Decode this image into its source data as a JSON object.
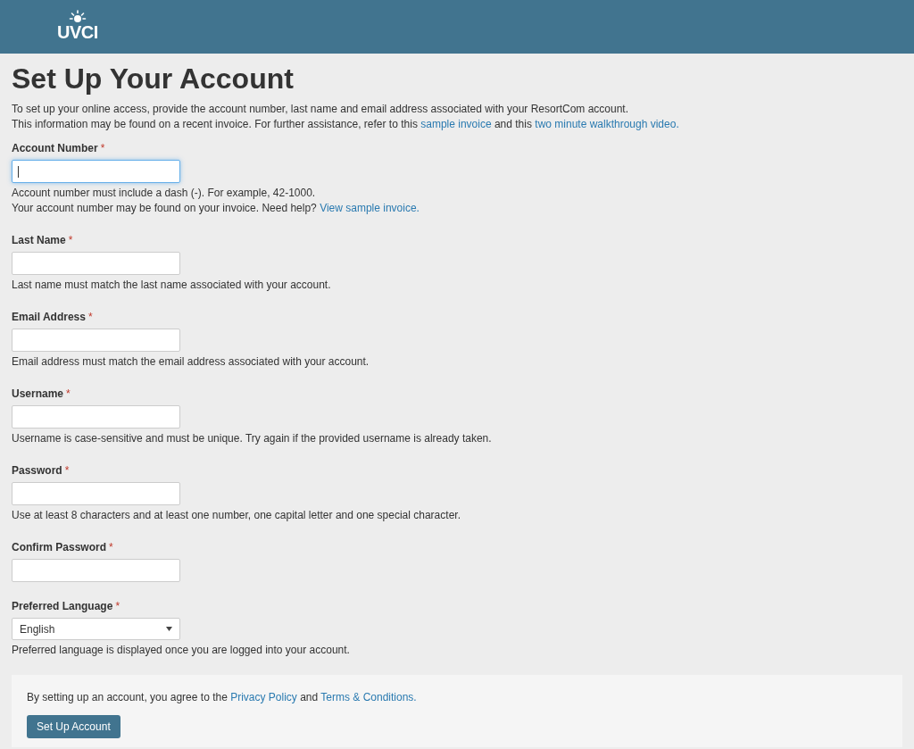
{
  "header": {
    "logo_text": "UVCI"
  },
  "title": "Set Up Your Account",
  "intro": [
    [
      {
        "kind": "text",
        "text": "To set up your online access, provide the account number, last name and email address associated with your ResortCom account."
      }
    ],
    [
      {
        "kind": "text",
        "text": "This information may be found on a recent invoice. For further assistance, refer to this "
      },
      {
        "kind": "link",
        "text": "sample invoice"
      },
      {
        "kind": "text",
        "text": " and this "
      },
      {
        "kind": "link",
        "text": "two minute walkthrough video."
      }
    ]
  ],
  "fields": [
    {
      "label": "Account Number",
      "required_mark": "*",
      "kind": "input",
      "focused": true,
      "help": [
        [
          {
            "kind": "text",
            "text": "Account number must include a dash (-). For example, 42-1000."
          }
        ],
        [
          {
            "kind": "text",
            "text": "Your account number may be found on your invoice. Need help? "
          },
          {
            "kind": "link",
            "text": "View sample invoice."
          }
        ]
      ]
    },
    {
      "label": "Last Name",
      "required_mark": "*",
      "kind": "input",
      "focused": false,
      "help": [
        [
          {
            "kind": "text",
            "text": "Last name must match the last name associated with your account."
          }
        ]
      ]
    },
    {
      "label": "Email Address",
      "required_mark": "*",
      "kind": "input",
      "focused": false,
      "help": [
        [
          {
            "kind": "text",
            "text": "Email address must match the email address associated with your account."
          }
        ]
      ]
    },
    {
      "label": "Username",
      "required_mark": "*",
      "kind": "input",
      "focused": false,
      "help": [
        [
          {
            "kind": "text",
            "text": "Username is case-sensitive and must be unique. Try again if the provided username is already taken."
          }
        ]
      ]
    },
    {
      "label": "Password",
      "required_mark": "*",
      "kind": "input",
      "focused": false,
      "help": [
        [
          {
            "kind": "text",
            "text": "Use at least 8 characters and at least one number, one capital letter and one special character."
          }
        ]
      ]
    },
    {
      "label": "Confirm Password",
      "required_mark": "*",
      "kind": "input",
      "focused": false
    },
    {
      "label": "Preferred Language",
      "required_mark": "*",
      "kind": "select",
      "value": "English",
      "help": [
        [
          {
            "kind": "text",
            "text": "Preferred language is displayed once you are logged into your account."
          }
        ]
      ]
    }
  ],
  "footer": {
    "agreement": [
      {
        "kind": "text",
        "text": "By setting up an account, you agree to the "
      },
      {
        "kind": "link",
        "text": "Privacy Policy"
      },
      {
        "kind": "text",
        "text": " and "
      },
      {
        "kind": "link",
        "text": "Terms & Conditions."
      }
    ],
    "button": "Set Up Account"
  }
}
